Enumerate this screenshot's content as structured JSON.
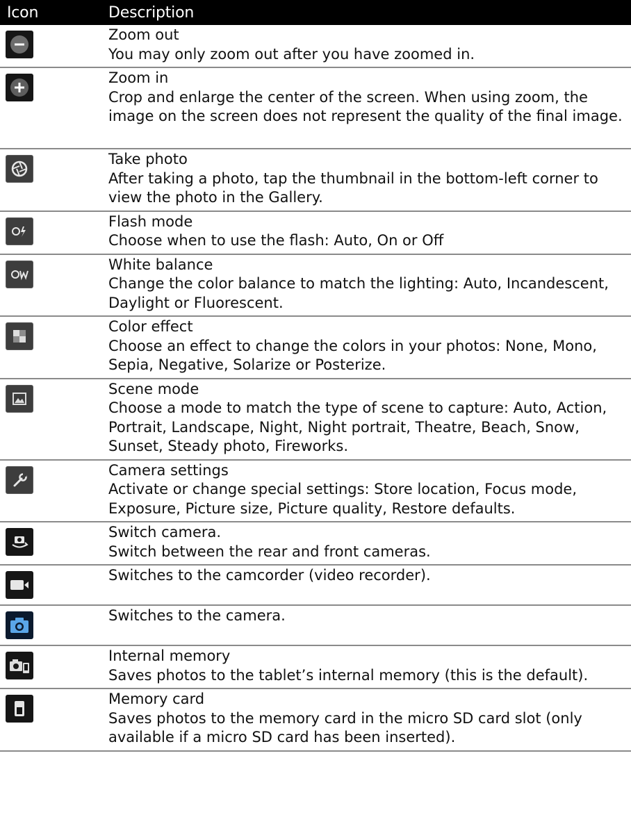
{
  "table": {
    "headers": {
      "icon": "Icon",
      "description": "Description"
    },
    "rows": [
      {
        "icon": "zoom-out-icon",
        "title": "Zoom out",
        "text": "You may only zoom out after you have zoomed in."
      },
      {
        "icon": "zoom-in-icon",
        "title": "Zoom in",
        "text": "Crop and enlarge the center of the screen. When using zoom, the image on the screen does not represent the quality of the final image."
      },
      {
        "icon": "shutter-icon",
        "title": "Take photo",
        "text": "After taking a photo, tap the thumbnail in the bottom-left corner to view the photo in the Gallery."
      },
      {
        "icon": "flash-icon",
        "title": "Flash mode",
        "text": "Choose when to use the flash: Auto, On or Off"
      },
      {
        "icon": "white-balance-icon",
        "title": "White balance",
        "text": "Change the color balance to match the lighting: Auto, Incandescent, Daylight or Fluorescent."
      },
      {
        "icon": "color-effect-icon",
        "title": "Color effect",
        "text": "Choose an effect to change the colors in your photos: None, Mono, Sepia, Negative, Solarize or Posterize."
      },
      {
        "icon": "scene-mode-icon",
        "title": "Scene mode",
        "text": "Choose a mode to match the type of scene to capture: Auto, Action, Portrait, Landscape, Night, Night portrait, Theatre, Beach, Snow, Sunset, Steady photo, Fireworks."
      },
      {
        "icon": "wrench-icon",
        "title": "Camera settings",
        "text": "Activate or change special settings: Store location, Focus mode, Exposure, Picture size, Picture quality, Restore defaults."
      },
      {
        "icon": "switch-camera-icon",
        "title": "Switch camera.",
        "text": "Switch between the rear and front cameras."
      },
      {
        "icon": "camcorder-icon",
        "title": "Switches to the camcorder (video recorder).",
        "text": ""
      },
      {
        "icon": "camera-icon",
        "title": "Switches to the camera.",
        "text": ""
      },
      {
        "icon": "internal-memory-icon",
        "title": "Internal memory",
        "text": "Saves photos to the tablet’s internal memory (this is the default)."
      },
      {
        "icon": "memory-card-icon",
        "title": "Memory card",
        "text": "Saves photos to the memory card in the micro SD card slot (only available if a micro SD card has been inserted)."
      }
    ]
  },
  "colors": {
    "header_bg": "#000000",
    "header_text": "#ffffff",
    "row_divider": "#8a8a8a",
    "camera_icon_blue": "#5aa6e8"
  }
}
